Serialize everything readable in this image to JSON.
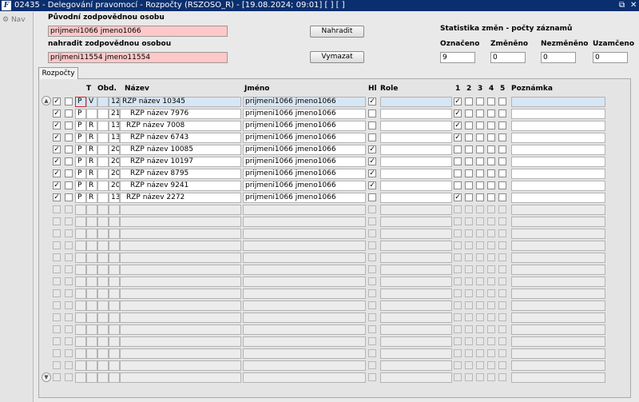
{
  "window": {
    "app_icon": "F",
    "title": "02435 - Delegování pravomocí - Rozpočty (RSZOSO_R) - [19.08.2024; 09:01]  [ ]  [ ]",
    "restore_icon": "restore-icon",
    "close_icon": "close-icon"
  },
  "nav": {
    "label": "Nav",
    "icon": "nav-icon"
  },
  "form": {
    "orig_label": "Původní zodpovědnou osobu",
    "orig_value": "prijmeni1066 jmeno1066",
    "new_label": "nahradit zodpovědnou osobou",
    "new_value": "prijmeni11554 jmeno11554",
    "replace_button": "Nahradit",
    "delete_button": "Vymazat"
  },
  "stats": {
    "title": "Statistika změn - počty záznamů",
    "labels": [
      "Označeno",
      "Změněno",
      "Nezměněno",
      "Uzamčeno"
    ],
    "values": [
      "9",
      "0",
      "0",
      "0"
    ]
  },
  "tab": {
    "label": "Rozpočty"
  },
  "table": {
    "headers": {
      "t": "T",
      "obd": "Obd.",
      "nazev": "Název",
      "jmeno": "Jméno",
      "hl": "Hl",
      "role": "Role",
      "c1": "1",
      "c2": "2",
      "c3": "3",
      "c4": "4",
      "c5": "5",
      "poznamka": "Poznámka"
    },
    "rows": [
      {
        "sel": true,
        "p": "P",
        "t": "V",
        "obd": "12",
        "nazev": "RZP název 10345",
        "indent": 0,
        "jmeno": "prijmeni1066 jmeno1066",
        "hl": true,
        "c1": true
      },
      {
        "sel": true,
        "p": "P",
        "t": "",
        "obd": "21",
        "nazev": "RZP název 7976",
        "indent": 2,
        "jmeno": "prijmeni1066 jmeno1066",
        "hl": false,
        "c1": true
      },
      {
        "sel": true,
        "p": "P",
        "t": "R",
        "obd": "13",
        "nazev": "RZP název 7008",
        "indent": 1,
        "jmeno": "prijmeni1066 jmeno1066",
        "hl": false,
        "c1": true
      },
      {
        "sel": true,
        "p": "P",
        "t": "R",
        "obd": "13",
        "nazev": "RZP název 6743",
        "indent": 2,
        "jmeno": "prijmeni1066 jmeno1066",
        "hl": false,
        "c1": true
      },
      {
        "sel": true,
        "p": "P",
        "t": "R",
        "obd": "20",
        "nazev": "RZP název 10085",
        "indent": 2,
        "jmeno": "prijmeni1066 jmeno1066",
        "hl": true,
        "c1": false
      },
      {
        "sel": true,
        "p": "P",
        "t": "R",
        "obd": "20",
        "nazev": "RZP název 10197",
        "indent": 2,
        "jmeno": "prijmeni1066 jmeno1066",
        "hl": true,
        "c1": false
      },
      {
        "sel": true,
        "p": "P",
        "t": "R",
        "obd": "20",
        "nazev": "RZP název 8795",
        "indent": 2,
        "jmeno": "prijmeni1066 jmeno1066",
        "hl": true,
        "c1": false
      },
      {
        "sel": true,
        "p": "P",
        "t": "R",
        "obd": "20",
        "nazev": "RZP název 9241",
        "indent": 2,
        "jmeno": "prijmeni1066 jmeno1066",
        "hl": true,
        "c1": false
      },
      {
        "sel": true,
        "p": "P",
        "t": "R",
        "obd": "13",
        "nazev": "RZP název 2272",
        "indent": 1,
        "jmeno": "prijmeni1066 jmeno1066",
        "hl": false,
        "c1": true
      }
    ],
    "empty_rows": 15
  }
}
